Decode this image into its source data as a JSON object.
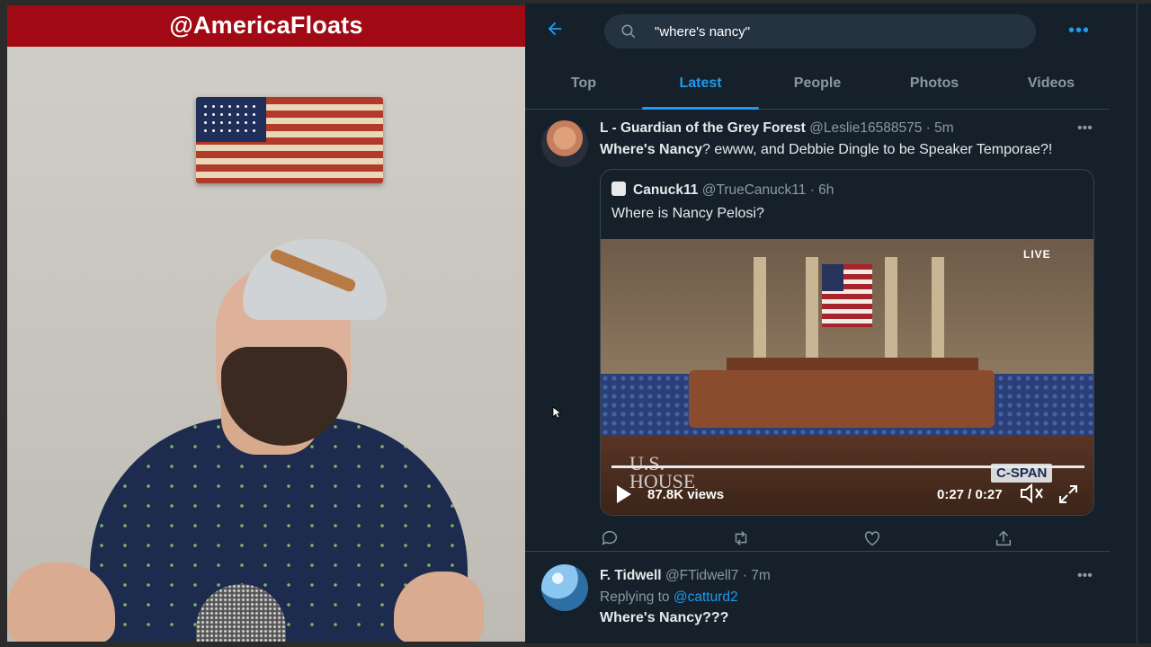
{
  "stream": {
    "banner": "@AmericaFloats"
  },
  "search": {
    "query": "\"where's nancy\""
  },
  "tabs": [
    {
      "label": "Top",
      "active": false
    },
    {
      "label": "Latest",
      "active": true
    },
    {
      "label": "People",
      "active": false
    },
    {
      "label": "Photos",
      "active": false
    },
    {
      "label": "Videos",
      "active": false
    }
  ],
  "tweets": [
    {
      "name": "L - Guardian of the Grey Forest",
      "handle": "@Leslie16588575",
      "time": "· 5m",
      "text_bold": "Where's Nancy",
      "text_rest": "? ewww, and Debbie Dingle to be Speaker Temporae?!",
      "quote": {
        "name": "Canuck11",
        "handle": "@TrueCanuck11",
        "time": "· 6h",
        "text": "Where is Nancy Pelosi?",
        "video": {
          "live_label": "LIVE",
          "logo_line1": "U.S.",
          "logo_line2": "HOUSE",
          "network": "C-SPAN",
          "views": "87.8K views",
          "time": "0:27 / 0:27",
          "progress": 1.0
        }
      }
    },
    {
      "name": "F. Tidwell",
      "handle": "@FTidwell7",
      "time": "· 7m",
      "reply_prefix": "Replying to",
      "reply_to": "@catturd2",
      "text": "Where's Nancy???"
    }
  ],
  "colors": {
    "accent": "#1d9bf0",
    "background": "#15202b",
    "banner": "#a10a14"
  }
}
